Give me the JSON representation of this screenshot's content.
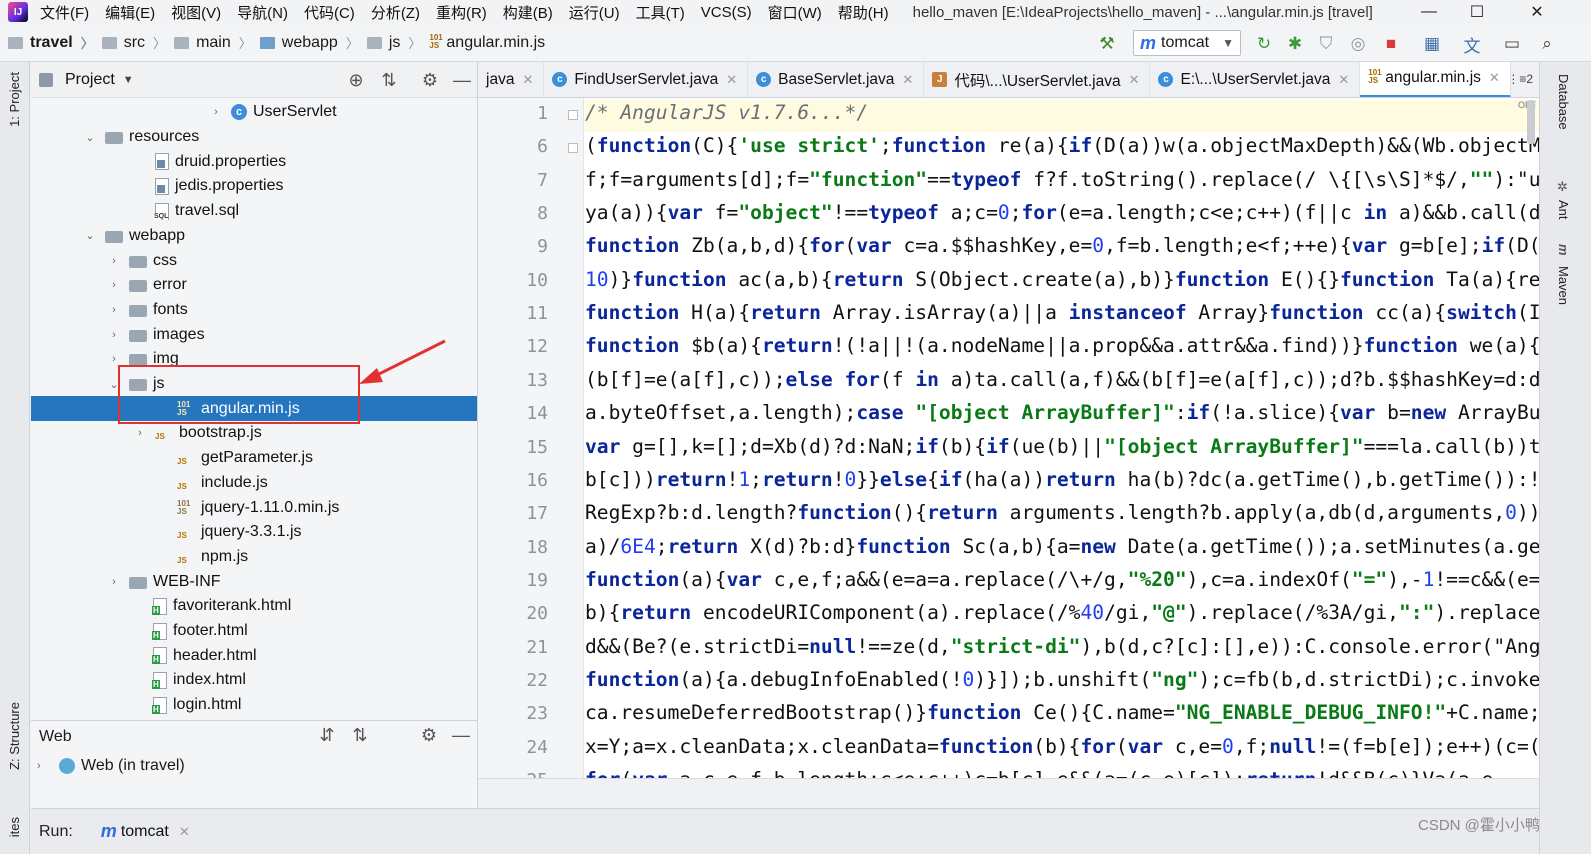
{
  "menubar": {
    "items": [
      "文件(F)",
      "编辑(E)",
      "视图(V)",
      "导航(N)",
      "代码(C)",
      "分析(Z)",
      "重构(R)",
      "构建(B)",
      "运行(U)",
      "工具(T)",
      "VCS(S)",
      "窗口(W)",
      "帮助(H)"
    ],
    "window_title": "hello_maven [E:\\IdeaProjects\\hello_maven] - ...\\angular.min.js [travel]",
    "minimize": "—",
    "maximize": "☐",
    "close": "✕"
  },
  "navbar": {
    "breadcrumb": [
      "travel",
      "src",
      "main",
      "webapp",
      "js",
      "angular.min.js"
    ],
    "run_config": "tomcat"
  },
  "left_stripe": {
    "project_tab": "1: Project",
    "structure_tab": "Z: Structure",
    "favorites_tab": "ites"
  },
  "project_panel": {
    "title": "Project",
    "tree": [
      {
        "label": "UserServlet",
        "icon": "class",
        "arrow": "›"
      },
      {
        "label": "resources",
        "icon": "folder",
        "arrow": "⌄"
      },
      {
        "label": "druid.properties",
        "icon": "properties",
        "arrow": ""
      },
      {
        "label": "jedis.properties",
        "icon": "properties",
        "arrow": ""
      },
      {
        "label": "travel.sql",
        "icon": "sql",
        "arrow": ""
      },
      {
        "label": "webapp",
        "icon": "folder",
        "arrow": "⌄"
      },
      {
        "label": "css",
        "icon": "folder",
        "arrow": "›"
      },
      {
        "label": "error",
        "icon": "folder",
        "arrow": "›"
      },
      {
        "label": "fonts",
        "icon": "folder",
        "arrow": "›"
      },
      {
        "label": "images",
        "icon": "folder",
        "arrow": "›"
      },
      {
        "label": "img",
        "icon": "folder",
        "arrow": "›"
      },
      {
        "label": "js",
        "icon": "folder",
        "arrow": "⌄"
      },
      {
        "label": "angular.min.js",
        "icon": "js-min",
        "arrow": "",
        "selected": true
      },
      {
        "label": "bootstrap.js",
        "icon": "js",
        "arrow": "›"
      },
      {
        "label": "getParameter.js",
        "icon": "js",
        "arrow": ""
      },
      {
        "label": "include.js",
        "icon": "js",
        "arrow": ""
      },
      {
        "label": "jquery-1.11.0.min.js",
        "icon": "js-min",
        "arrow": ""
      },
      {
        "label": "jquery-3.3.1.js",
        "icon": "js",
        "arrow": ""
      },
      {
        "label": "npm.js",
        "icon": "js",
        "arrow": ""
      },
      {
        "label": "WEB-INF",
        "icon": "folder",
        "arrow": "›"
      },
      {
        "label": "favoriterank.html",
        "icon": "html",
        "arrow": ""
      },
      {
        "label": "footer.html",
        "icon": "html",
        "arrow": ""
      },
      {
        "label": "header.html",
        "icon": "html",
        "arrow": ""
      },
      {
        "label": "index.html",
        "icon": "html",
        "arrow": ""
      },
      {
        "label": "login.html",
        "icon": "html",
        "arrow": ""
      }
    ]
  },
  "web_panel": {
    "title": "Web",
    "item": "Web (in travel)"
  },
  "editor_tabs": [
    {
      "label": "java",
      "icon": "",
      "active": false
    },
    {
      "label": "FindUserServlet.java",
      "icon": "class",
      "active": false
    },
    {
      "label": "BaseServlet.java",
      "icon": "class",
      "active": false
    },
    {
      "label": "代码\\...\\UserServlet.java",
      "icon": "file",
      "active": false
    },
    {
      "label": "E:\\...\\UserServlet.java",
      "icon": "class",
      "active": false
    },
    {
      "label": "angular.min.js",
      "icon": "js-min",
      "active": true
    }
  ],
  "tabs_more": "⋮≡2",
  "editor": {
    "line_numbers": [
      "1",
      "6",
      "7",
      "8",
      "9",
      "10",
      "11",
      "12",
      "13",
      "14",
      "15",
      "16",
      "17",
      "18",
      "19",
      "20",
      "21",
      "22",
      "23",
      "24",
      "25"
    ],
    "lines": [
      "/* AngularJS v1.7.6...*/",
      "(function(C){'use strict';function re(a){if(D(a))w(a.objectMaxDepth)&&(Wb.objectM",
      "f;f=arguments[d];f=\"function\"==typeof f?f.toString().replace(/ \\{[\\s\\S]*$/,\"\"):\"u",
      "ya(a)){var f=\"object\"!==typeof a;c=0;for(e=a.length;c<e;c++)(f||c in a)&&b.call(d",
      "function Zb(a,b,d){for(var c=a.$$hashKey,e=0,f=b.length;e<f;++e){var g=b[e];if(D(",
      "10)}function ac(a,b){return S(Object.create(a),b)}function E(){}function Ta(a){re",
      "function H(a){return Array.isArray(a)||a instanceof Array}function cc(a){switch(I",
      "function $b(a){return!(!a||!(a.nodeName||a.prop&&a.attr&&a.find))}function we(a){",
      "(b[f]=e(a[f],c));else for(f in a)ta.call(a,f)&&(b[f]=e(a[f],c));d?b.$$hashKey=d:d",
      "a.byteOffset,a.length);case \"[object ArrayBuffer]\":if(!a.slice){var b=new ArrayBu",
      "var g=[],k=[];d=Xb(d)?d:NaN;if(b){if(ue(b)||\"[object ArrayBuffer]\"===la.call(b))t",
      "b[c]))return!1;return!0}}else{if(ha(a))return ha(b)?dc(a.getTime(),b.getTime()):!",
      "RegExp?b:d.length?function(){return arguments.length?b.apply(a,db(d,arguments,0))",
      "a)/6E4;return X(d)?b:d}function Sc(a,b){a=new Date(a.getTime());a.setMinutes(a.ge",
      "function(a){var c,e,f;a&&(e=a=a.replace(/\\+/g,\"%20\"),c=a.indexOf(\"=\"),-1!==c&&(e=",
      "b){return encodeURIComponent(a).replace(/%40/gi,\"@\").replace(/%3A/gi,\":\").replace",
      "d&&(Be?(e.strictDi=null!==ze(d,\"strict-di\"),b(d,c?[c]:[],e)):C.console.error(\"Ang",
      "function(a){a.debugInfoEnabled(!0)}]);b.unshift(\"ng\");c=fb(b,d.strictDi);c.invoke",
      "ca.resumeDeferredBootstrap()}function Ce(){C.name=\"NG_ENABLE_DEBUG_INFO!\"+C.name;",
      "x=Y;a=x.cleanData;x.cleanData=function(b){for(var c,e=0,f;null!=(f=b[e]);e++)(c=(",
      "for(var a,c,e,f,b.length;c<e;c++)c=b[c],e&&(a=(c,e)[c]);return!d&&B(c)}Va(a,e"
    ],
    "off_label": "OFF"
  },
  "right_stripe": {
    "database": "Database",
    "ant": "Ant",
    "maven": "Maven"
  },
  "run_bar": {
    "label": "Run:",
    "config": "tomcat"
  },
  "watermark": "CSDN @霍小小鸭",
  "colors": {
    "selection": "#2675bf",
    "highlight_box": "#e0302f",
    "keyword": "#0b2699",
    "string": "#0a7a16",
    "number": "#1f3ff0"
  }
}
